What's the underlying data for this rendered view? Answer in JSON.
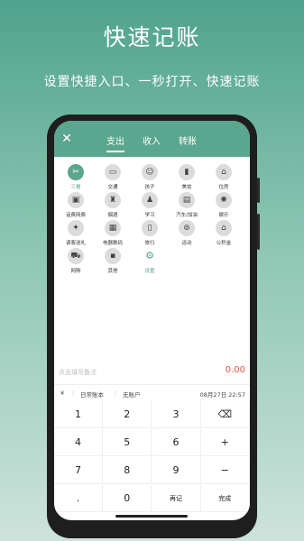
{
  "headline": "快速记账",
  "subline": "设置快捷入口、一秒打开、快速记账",
  "app": {
    "close_icon": "close-icon",
    "tabs": [
      "支出",
      "收入",
      "转账"
    ],
    "active_tab": "支出",
    "categories": [
      {
        "label": "三餐",
        "icon": "utensils-icon",
        "selected": true
      },
      {
        "label": "交通",
        "icon": "bus-icon"
      },
      {
        "label": "孩子",
        "icon": "child-icon"
      },
      {
        "label": "美妆",
        "icon": "lipstick-icon"
      },
      {
        "label": "住房",
        "icon": "house-icon"
      },
      {
        "label": "话费网费",
        "icon": "phone-icon"
      },
      {
        "label": "烟酒",
        "icon": "bottle-icon"
      },
      {
        "label": "学习",
        "icon": "school-icon"
      },
      {
        "label": "汽车/加油",
        "icon": "fuel-icon"
      },
      {
        "label": "娱乐",
        "icon": "ferris-wheel-icon"
      },
      {
        "label": "请客送礼",
        "icon": "gift-icon"
      },
      {
        "label": "电器数码",
        "icon": "tv-icon"
      },
      {
        "label": "旅行",
        "icon": "suitcase-icon"
      },
      {
        "label": "运动",
        "icon": "bike-icon"
      },
      {
        "label": "公积金",
        "icon": "fund-icon"
      },
      {
        "label": "网购",
        "icon": "cart-icon"
      },
      {
        "label": "其他",
        "icon": "grid-icon"
      },
      {
        "label": "设置",
        "icon": "gear-icon",
        "setting": true
      }
    ],
    "note_placeholder": "点击填写备注",
    "amount": "0.00",
    "meta": {
      "currency_symbol": "¥",
      "ledger": "日常账本",
      "account": "无账户",
      "datetime": "08月27日 22:57"
    },
    "keypad": [
      [
        "1",
        "2",
        "3",
        "⌫"
      ],
      [
        "4",
        "5",
        "6",
        "+"
      ],
      [
        "7",
        "8",
        "9",
        "−"
      ],
      [
        ".",
        "0",
        "再记",
        "完成"
      ]
    ]
  }
}
